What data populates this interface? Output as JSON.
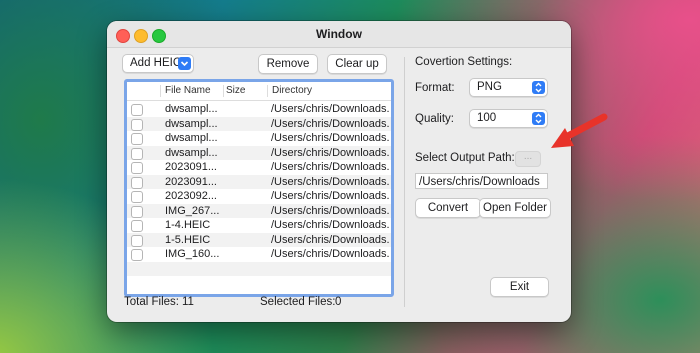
{
  "window": {
    "title": "Window"
  },
  "toolbar": {
    "add_heic_label": "Add HEIC",
    "remove_label": "Remove",
    "clear_label": "Clear up"
  },
  "table": {
    "headers": [
      "File Name",
      "Size",
      "Directory"
    ],
    "rows": [
      {
        "name": "dwsampl...",
        "size": "",
        "dir": "/Users/chris/Downloads..."
      },
      {
        "name": "dwsampl...",
        "size": "",
        "dir": "/Users/chris/Downloads..."
      },
      {
        "name": "dwsampl...",
        "size": "",
        "dir": "/Users/chris/Downloads..."
      },
      {
        "name": "dwsampl...",
        "size": "",
        "dir": "/Users/chris/Downloads..."
      },
      {
        "name": "2023091...",
        "size": "",
        "dir": "/Users/chris/Downloads..."
      },
      {
        "name": "2023091...",
        "size": "",
        "dir": "/Users/chris/Downloads..."
      },
      {
        "name": "2023092...",
        "size": "",
        "dir": "/Users/chris/Downloads..."
      },
      {
        "name": "IMG_267...",
        "size": "",
        "dir": "/Users/chris/Downloads..."
      },
      {
        "name": "1-4.HEIC",
        "size": "",
        "dir": "/Users/chris/Downloads..."
      },
      {
        "name": "1-5.HEIC",
        "size": "",
        "dir": "/Users/chris/Downloads..."
      },
      {
        "name": "IMG_160...",
        "size": "",
        "dir": "/Users/chris/Downloads..."
      }
    ]
  },
  "status": {
    "total_label": "Total Files:",
    "total_value": "11",
    "selected_label": "Selected Files:",
    "selected_value": "0"
  },
  "settings": {
    "heading": "Covertion Settings:",
    "format_label": "Format:",
    "format_value": "PNG",
    "quality_label": "Quality:",
    "quality_value": "100",
    "output_label": "Select Output Path:",
    "browse_label": "...",
    "output_path": "/Users/chris/Downloads",
    "convert_label": "Convert",
    "open_folder_label": "Open Folder",
    "exit_label": "Exit"
  },
  "colors": {
    "accent": "#2f7cf6",
    "annotation_arrow": "#e8332a"
  }
}
